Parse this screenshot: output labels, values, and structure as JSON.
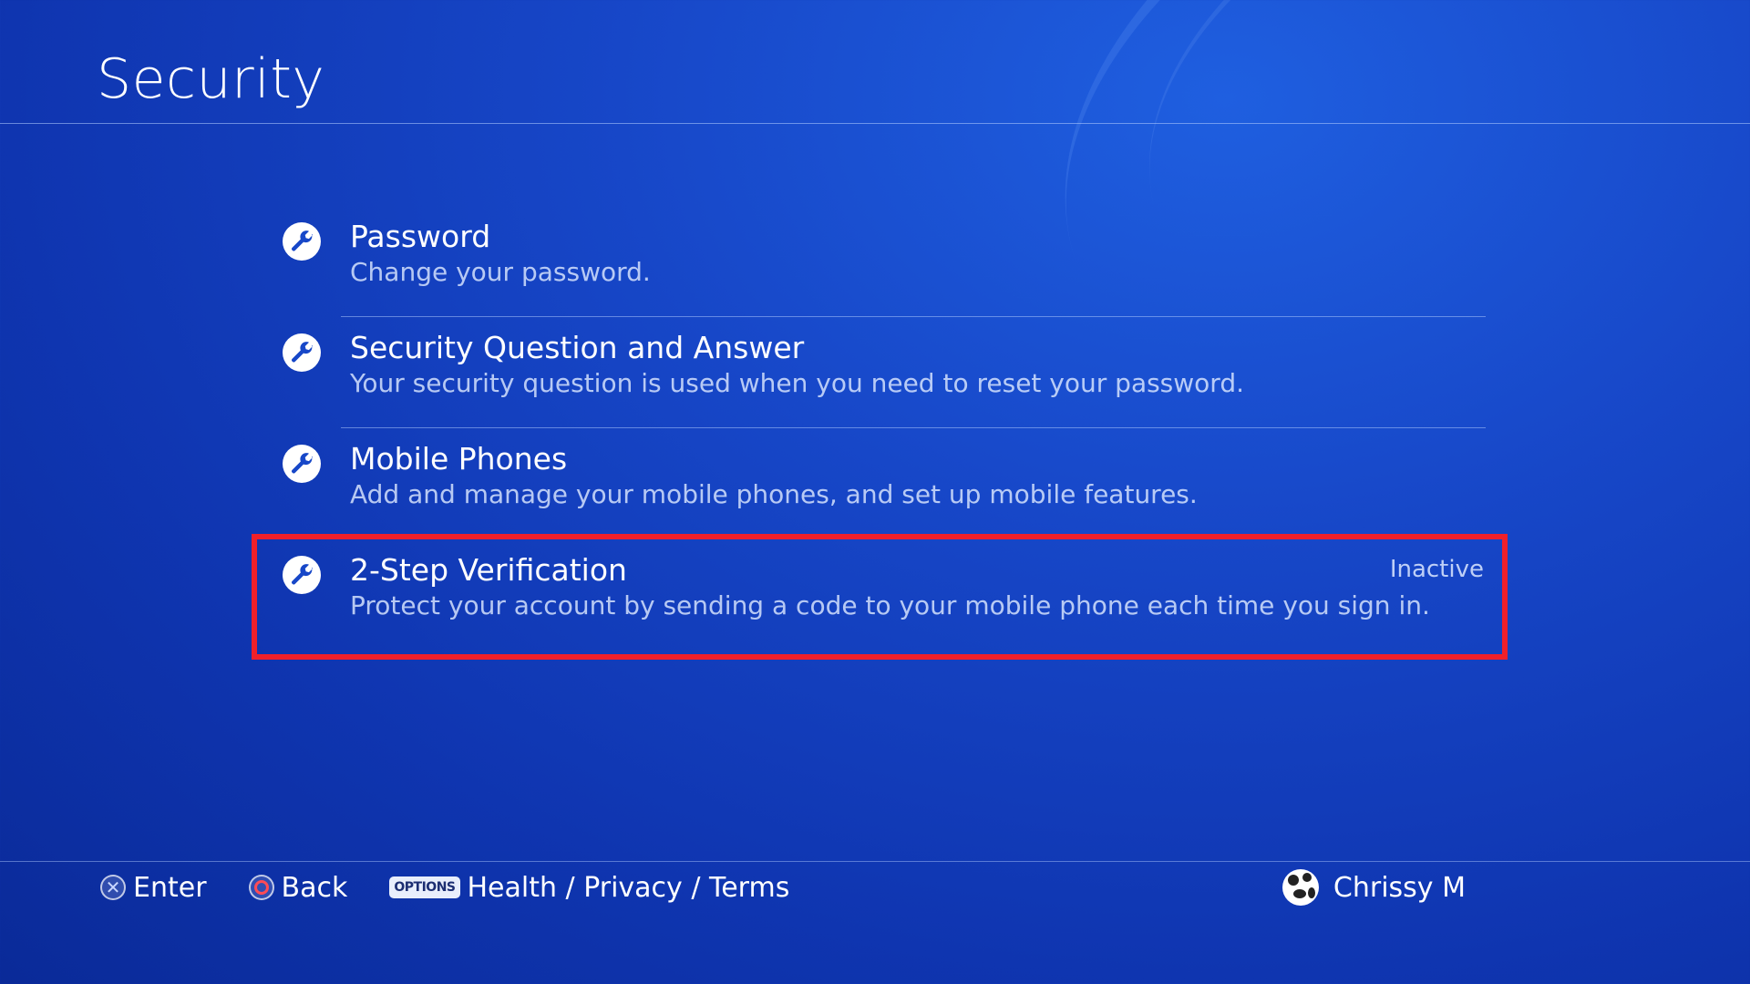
{
  "page": {
    "title": "Security"
  },
  "menu": {
    "items": [
      {
        "label": "Password",
        "description": "Change your password.",
        "icon": "wrench-icon",
        "status": ""
      },
      {
        "label": "Security Question and Answer",
        "description": "Your security question is used when you need to reset your password.",
        "icon": "wrench-icon",
        "status": ""
      },
      {
        "label": "Mobile Phones",
        "description": "Add and manage your mobile phones, and set up mobile features.",
        "icon": "wrench-icon",
        "status": ""
      },
      {
        "label": "2-Step Verification",
        "description": "Protect your account by sending a code to your mobile phone each time you sign in.",
        "icon": "wrench-icon",
        "status": "Inactive"
      }
    ]
  },
  "footer": {
    "enter_label": "Enter",
    "back_label": "Back",
    "options_badge": "OPTIONS",
    "options_label": "Health / Privacy / Terms",
    "user_name": "Chrissy M"
  },
  "colors": {
    "highlight": "#f0202a",
    "background": "#1747c8"
  }
}
